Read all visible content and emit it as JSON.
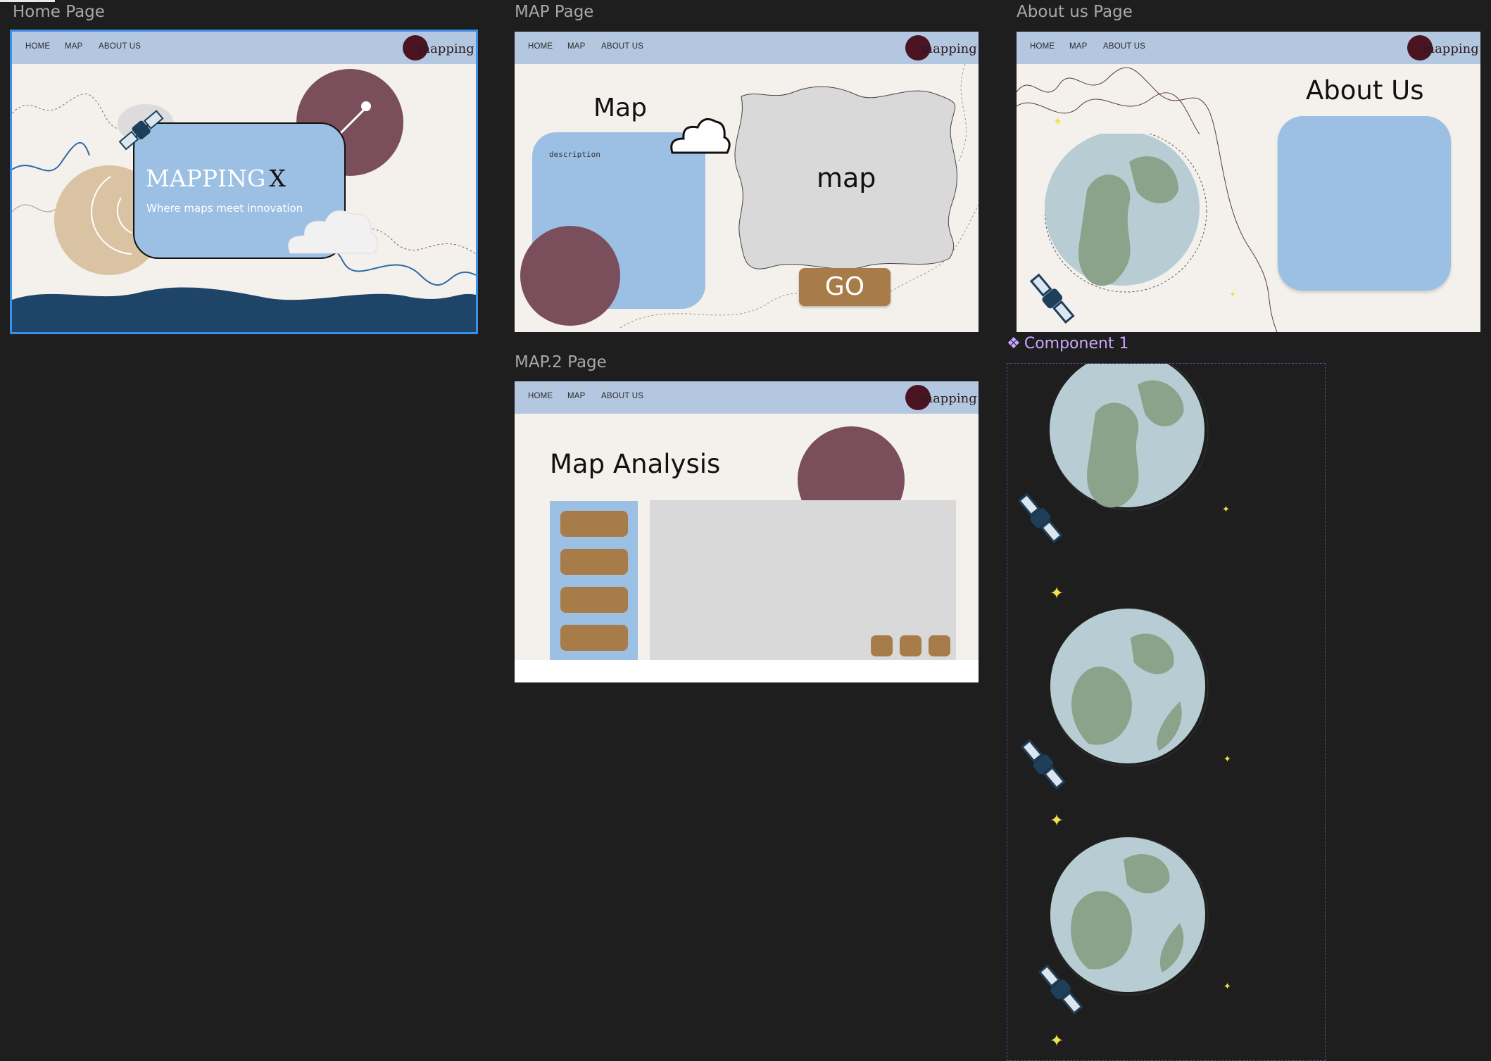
{
  "canvas": {
    "top_tab": "",
    "frames": [
      {
        "id": "home",
        "label": "Home Page"
      },
      {
        "id": "map",
        "label": "MAP Page"
      },
      {
        "id": "about",
        "label": "About us Page"
      },
      {
        "id": "map2",
        "label": "MAP.2 Page"
      }
    ],
    "component_label": "Component 1"
  },
  "nav": {
    "home": "HOME",
    "map": "MAP",
    "about": "ABOUT US",
    "logo_text": "mapping"
  },
  "home": {
    "title": "MAPPING",
    "title_mark": "X",
    "tagline": "Where maps meet innovation"
  },
  "map_page": {
    "heading": "Map",
    "description": "description",
    "map_label": "map",
    "go_button": "GO"
  },
  "about_page": {
    "heading": "About Us"
  },
  "map2_page": {
    "heading": "Map Analysis",
    "sidebar_buttons": 4,
    "bottom_buttons": 3
  },
  "colors": {
    "page_bg": "#f4f1ec",
    "nav_bg": "#b4c7e0",
    "card_blue": "#9cbfe4",
    "maroon": "#7b4e5c",
    "tan": "#d9c3a3",
    "gold": "#a87c48",
    "grey_panel": "#d9d9d9",
    "ocean": "#1e4467",
    "earth_sea": "#b8ccd4",
    "earth_land": "#8aa38a",
    "satellite": "#1e3e5a",
    "star": "#f2e04a",
    "selection": "#3d8fe8",
    "component_accent": "#c9a6ff"
  },
  "icons": [
    "satellite-icon",
    "cloud-icon",
    "earth-icon",
    "star-icon",
    "component-icon",
    "logo-icon"
  ]
}
